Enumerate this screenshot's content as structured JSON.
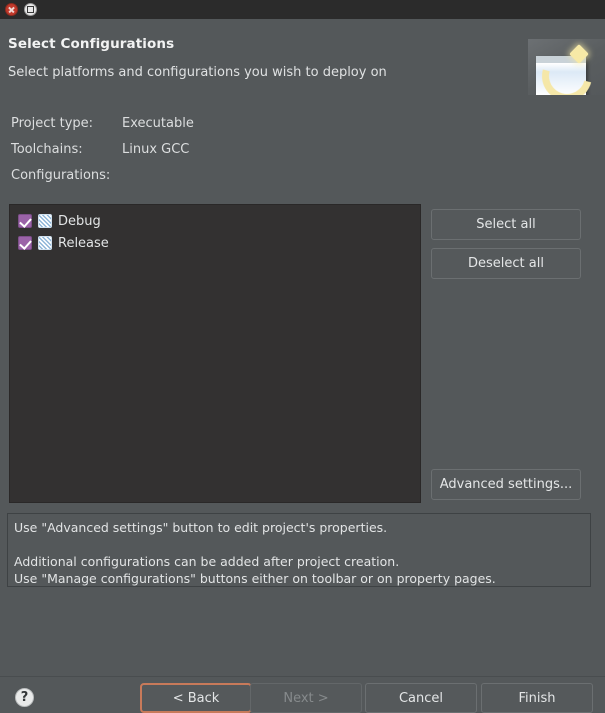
{
  "window": {
    "close_icon": "close-icon",
    "maximize_icon": "maximize-icon"
  },
  "header": {
    "title": "Select Configurations",
    "subtitle": "Select platforms and configurations you wish to deploy on",
    "banner_icon": "eclipse-new-project-banner"
  },
  "details": {
    "project_type_label": "Project type:",
    "project_type_value": "Executable",
    "toolchains_label": "Toolchains:",
    "toolchains_value": "Linux GCC",
    "configurations_label": "Configurations:"
  },
  "configurations": [
    {
      "label": "Debug",
      "checked": true,
      "icon": "build-config-icon"
    },
    {
      "label": "Release",
      "checked": true,
      "icon": "build-config-icon"
    }
  ],
  "side_buttons": {
    "select_all": "Select all",
    "deselect_all": "Deselect all",
    "advanced_settings": "Advanced settings..."
  },
  "info_text": {
    "line1": "Use \"Advanced settings\" button to edit project's properties.",
    "line2": "Additional configurations can be added after project creation.",
    "line3": "Use \"Manage configurations\" buttons either on toolbar or on property pages."
  },
  "footer": {
    "help_icon": "?",
    "back": "< Back",
    "next": "Next >",
    "cancel": "Cancel",
    "finish": "Finish"
  },
  "colors": {
    "dialog_background": "#54585a",
    "titlebar_background": "#2b2b2b",
    "list_background": "#333131",
    "checkbox_accent": "#9b63a8",
    "focus_ring": "#c87a5a",
    "close_button": "#c0392b",
    "text": "#d8dadb",
    "disabled_text": "#868a8c"
  }
}
